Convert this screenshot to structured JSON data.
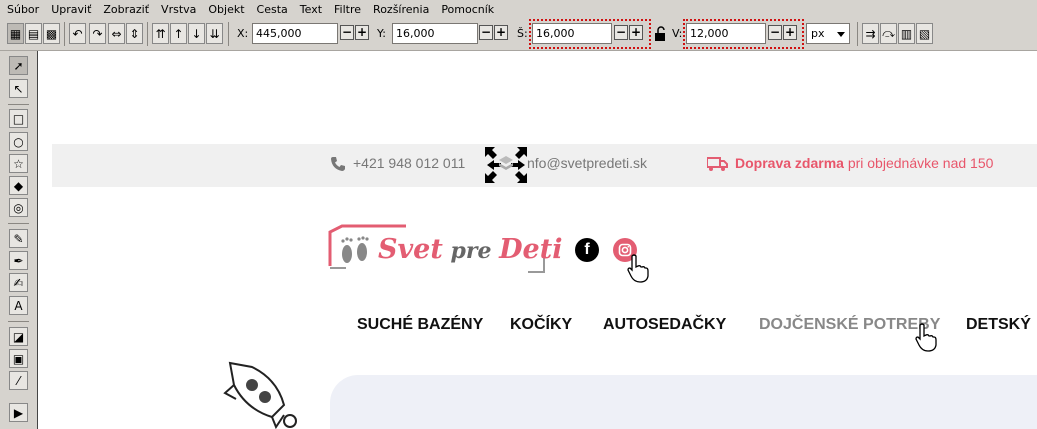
{
  "menu": [
    "Súbor",
    "Upraviť",
    "Zobraziť",
    "Vrstva",
    "Objekt",
    "Cesta",
    "Text",
    "Filtre",
    "Rozšírenia",
    "Pomocník"
  ],
  "toolbar": {
    "x_label": "X:",
    "x_value": "445,000",
    "y_label": "Y:",
    "y_value": "16,000",
    "w_label": "Š:",
    "w_value": "16,000",
    "h_label": "V:",
    "h_value": "12,000",
    "unit": "px",
    "spin_minus": "−",
    "spin_plus": "+"
  },
  "site": {
    "phone": "+421 948 012 011",
    "email": "nfo@svetpredeti.sk",
    "shipping_bold": "Doprava zdarma",
    "shipping_rest": " pri objednávke nad 150",
    "logo_main": "Svet",
    "logo_mid": " pre ",
    "logo_end": "Deti",
    "fb_letter": "f",
    "nav": [
      "SUCHÉ BAZÉNY",
      "KOČÍKY",
      "AUTOSEDAČKY",
      "DOJČENSKÉ POTREBY",
      "DETSKÝ"
    ]
  },
  "colors": {
    "accent": "#e35d72",
    "selection": "#d01010",
    "nav_active": "#888888"
  }
}
